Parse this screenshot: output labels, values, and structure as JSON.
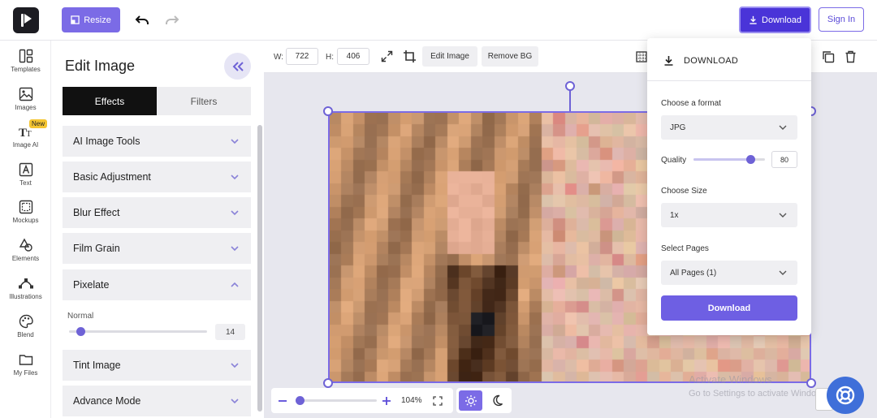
{
  "header": {
    "resize_label": "Resize",
    "download_label": "Download",
    "signin_label": "Sign In"
  },
  "rail": {
    "items": [
      {
        "label": "Templates",
        "icon": "templates-icon"
      },
      {
        "label": "Images",
        "icon": "images-icon"
      },
      {
        "label": "Image AI",
        "icon": "image-ai-icon",
        "badge": "New"
      },
      {
        "label": "Text",
        "icon": "text-icon"
      },
      {
        "label": "Mockups",
        "icon": "mockups-icon"
      },
      {
        "label": "Elements",
        "icon": "elements-icon"
      },
      {
        "label": "Illustrations",
        "icon": "illustrations-icon"
      },
      {
        "label": "Blend",
        "icon": "blend-icon"
      },
      {
        "label": "My Files",
        "icon": "folder-icon"
      }
    ]
  },
  "panel": {
    "title": "Edit Image",
    "tabs": [
      {
        "label": "Effects",
        "active": true
      },
      {
        "label": "Filters",
        "active": false
      }
    ],
    "sections": [
      {
        "label": "AI Image Tools",
        "expanded": false
      },
      {
        "label": "Basic Adjustment",
        "expanded": false
      },
      {
        "label": "Blur Effect",
        "expanded": false
      },
      {
        "label": "Film Grain",
        "expanded": false
      },
      {
        "label": "Pixelate",
        "expanded": true
      },
      {
        "label": "Tint Image",
        "expanded": false
      },
      {
        "label": "Advance Mode",
        "expanded": false
      }
    ],
    "pixelate": {
      "mode_label": "Normal",
      "value": "14"
    }
  },
  "toolbar": {
    "width_label": "W:",
    "width_value": "722",
    "height_label": "H:",
    "height_value": "406",
    "edit_image_label": "Edit Image",
    "remove_bg_label": "Remove BG"
  },
  "zoom": {
    "value": "104%"
  },
  "download_popup": {
    "title": "DOWNLOAD",
    "format_label": "Choose a format",
    "format_value": "JPG",
    "quality_label": "Quality",
    "quality_value": "80",
    "size_label": "Choose Size",
    "size_value": "1x",
    "pages_label": "Select Pages",
    "pages_value": "All Pages (1)",
    "button_label": "Download"
  },
  "watermark": {
    "line1": "Activate Windows",
    "line2": "Go to Settings to activate Windows."
  },
  "colors": {
    "accent": "#7b6be6",
    "download_primary": "#4a34d8"
  }
}
